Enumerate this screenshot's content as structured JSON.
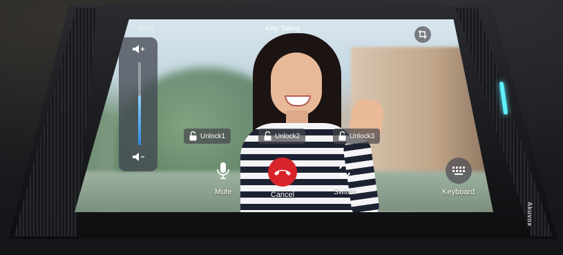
{
  "call": {
    "elapsed": "00:38",
    "title": "Kelly Talking"
  },
  "volume": {
    "level": 0.6
  },
  "unlocks": [
    {
      "label": "Unlock1",
      "icon": "padlock-open-icon"
    },
    {
      "label": "Unlock2",
      "icon": "padlock-open-icon"
    },
    {
      "label": "Unlock3",
      "icon": "padlock-open-icon"
    }
  ],
  "controls": {
    "mute": {
      "label": "Mute",
      "icon": "microphone-icon"
    },
    "cancel": {
      "label": "Cancel",
      "icon": "hang-up-icon",
      "color": "#d8232a"
    },
    "switch": {
      "label": "Switch",
      "icon": "switch-camera-icon"
    },
    "keyboard": {
      "label": "Keyboard",
      "icon": "keypad-icon"
    }
  },
  "device": {
    "brand": "Akuvox",
    "led_color": "#5ff0ff"
  }
}
